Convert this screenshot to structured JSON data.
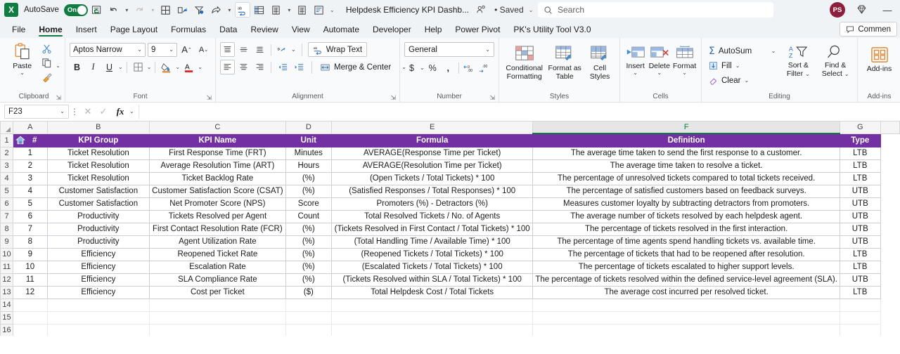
{
  "titlebar": {
    "app_logo": "excel-logo",
    "autosave_label": "AutoSave",
    "autosave_state": "On",
    "document_title": "Helpdesk Efficiency KPI Dashb...",
    "saved_status": "• Saved",
    "search_placeholder": "Search",
    "avatar_initials": "PS",
    "qat": [
      {
        "name": "refresh-all-icon",
        "glyph": "↻"
      },
      {
        "name": "undo-icon",
        "glyph": "↶"
      },
      {
        "name": "redo-icon",
        "glyph": "↷"
      },
      {
        "name": "all-borders-icon",
        "glyph": "⊞"
      },
      {
        "name": "insert-chart-icon",
        "glyph": "↗"
      },
      {
        "name": "filter-settings-icon",
        "glyph": "∇"
      },
      {
        "name": "share-icon",
        "glyph": "➦"
      },
      {
        "name": "spelling-icon",
        "glyph": "abc"
      },
      {
        "name": "freeze-panes-icon",
        "glyph": "▦"
      },
      {
        "name": "calculator-icon",
        "glyph": "⌸"
      },
      {
        "name": "calculate-sheet-icon",
        "glyph": "⌸"
      },
      {
        "name": "custom-sort-icon",
        "glyph": "≣"
      },
      {
        "name": "customize-qat-icon",
        "glyph": "⌄"
      }
    ]
  },
  "tabs": [
    {
      "label": "File",
      "selected": false
    },
    {
      "label": "Home",
      "selected": true
    },
    {
      "label": "Insert",
      "selected": false
    },
    {
      "label": "Page Layout",
      "selected": false
    },
    {
      "label": "Formulas",
      "selected": false
    },
    {
      "label": "Data",
      "selected": false
    },
    {
      "label": "Review",
      "selected": false
    },
    {
      "label": "View",
      "selected": false
    },
    {
      "label": "Automate",
      "selected": false
    },
    {
      "label": "Developer",
      "selected": false
    },
    {
      "label": "Help",
      "selected": false
    },
    {
      "label": "Power Pivot",
      "selected": false
    },
    {
      "label": "PK's Utility Tool V3.0",
      "selected": false
    }
  ],
  "comment_button": "Commen",
  "ribbon": {
    "clipboard": {
      "group_label": "Clipboard",
      "paste_label": "Paste",
      "cut_label": "Cut",
      "copy_label": "Copy",
      "format_painter_label": "Format Painter"
    },
    "font": {
      "group_label": "Font",
      "font_name": "Aptos Narrow",
      "font_size": "9",
      "grow_font": "A",
      "shrink_font": "A",
      "bold": "B",
      "italic": "I",
      "underline": "U",
      "borders": "borders",
      "fill_color": "fill-color",
      "font_color": "font-color"
    },
    "alignment": {
      "group_label": "Alignment",
      "wrap_text_label": "Wrap Text",
      "merge_center_label": "Merge & Center",
      "orientation": "orientation"
    },
    "number": {
      "group_label": "Number",
      "format_value": "General",
      "currency": "$",
      "percent": "%",
      "comma": ",",
      "increase_decimal": ".00",
      "decrease_decimal": ".00"
    },
    "styles": {
      "group_label": "Styles",
      "conditional_formatting": "Conditional\nFormatting",
      "cf_line1": "Conditional",
      "cf_line2": "Formatting",
      "fat_line1": "Format as",
      "fat_line2": "Table",
      "cs_line1": "Cell",
      "cs_line2": "Styles"
    },
    "cells": {
      "group_label": "Cells",
      "insert_label": "Insert",
      "delete_label": "Delete",
      "format_label": "Format"
    },
    "editing": {
      "group_label": "Editing",
      "autosum_label": "AutoSum",
      "fill_label": "Fill",
      "clear_label": "Clear",
      "sort_filter_line1": "Sort &",
      "sort_filter_line2": "Filter",
      "find_select_line1": "Find &",
      "find_select_line2": "Select"
    },
    "addins": {
      "group_label": "Add-ins",
      "button_label": "Add-ins"
    }
  },
  "formula_bar": {
    "name_box_value": "F23",
    "formula_value": "",
    "cancel_icon": "✕",
    "enter_icon": "✓",
    "fx_label": "fx"
  },
  "grid": {
    "columns": [
      "A",
      "B",
      "C",
      "D",
      "E",
      "F",
      "G"
    ],
    "selected_column": "F",
    "row_numbers": [
      "1",
      "2",
      "3",
      "4",
      "5",
      "6",
      "7",
      "8",
      "9",
      "10",
      "11",
      "12",
      "13",
      "14",
      "15",
      "16"
    ],
    "header_row": {
      "home_icon": "home-icon",
      "number_sign": "#",
      "kpi_group": "KPI Group",
      "kpi_name": "KPI Name",
      "unit": "Unit",
      "formula": "Formula",
      "definition": "Definition",
      "type": "Type"
    },
    "header_color": "#7230a3",
    "rows": [
      {
        "num": "1",
        "group": "Ticket Resolution",
        "name": "First Response Time (FRT)",
        "unit": "Minutes",
        "formula": "AVERAGE(Response Time per Ticket)",
        "definition": "The average time taken to send the first response to a customer.",
        "type": "LTB"
      },
      {
        "num": "2",
        "group": "Ticket Resolution",
        "name": "Average Resolution Time (ART)",
        "unit": "Hours",
        "formula": "AVERAGE(Resolution Time per Ticket)",
        "definition": "The average time taken to resolve a ticket.",
        "type": "LTB"
      },
      {
        "num": "3",
        "group": "Ticket Resolution",
        "name": "Ticket Backlog Rate",
        "unit": "(%)",
        "formula": "(Open Tickets / Total Tickets) * 100",
        "definition": "The percentage of unresolved tickets compared to total tickets received.",
        "type": "LTB"
      },
      {
        "num": "4",
        "group": "Customer Satisfaction",
        "name": "Customer Satisfaction Score (CSAT)",
        "unit": "(%)",
        "formula": "(Satisfied Responses / Total Responses) * 100",
        "definition": "The percentage of satisfied customers based on feedback surveys.",
        "type": "UTB"
      },
      {
        "num": "5",
        "group": "Customer Satisfaction",
        "name": "Net Promoter Score (NPS)",
        "unit": "Score",
        "formula": "Promoters (%) - Detractors (%)",
        "definition": "Measures customer loyalty by subtracting detractors from promoters.",
        "type": "UTB"
      },
      {
        "num": "6",
        "group": "Productivity",
        "name": "Tickets Resolved per Agent",
        "unit": "Count",
        "formula": "Total Resolved Tickets / No. of Agents",
        "definition": "The average number of tickets resolved by each helpdesk agent.",
        "type": "UTB"
      },
      {
        "num": "7",
        "group": "Productivity",
        "name": "First Contact Resolution Rate (FCR)",
        "unit": "(%)",
        "formula": "(Tickets Resolved in First Contact / Total Tickets) * 100",
        "definition": "The percentage of tickets resolved in the first interaction.",
        "type": "UTB"
      },
      {
        "num": "8",
        "group": "Productivity",
        "name": "Agent Utilization Rate",
        "unit": "(%)",
        "formula": "(Total Handling Time / Available Time) * 100",
        "definition": "The percentage of time agents spend handling tickets vs. available time.",
        "type": "UTB"
      },
      {
        "num": "9",
        "group": "Efficiency",
        "name": "Reopened Ticket Rate",
        "unit": "(%)",
        "formula": "(Reopened Tickets / Total Tickets) * 100",
        "definition": "The percentage of tickets that had to be reopened after resolution.",
        "type": "LTB"
      },
      {
        "num": "10",
        "group": "Efficiency",
        "name": "Escalation Rate",
        "unit": "(%)",
        "formula": "(Escalated Tickets / Total Tickets) * 100",
        "definition": "The percentage of tickets escalated to higher support levels.",
        "type": "LTB"
      },
      {
        "num": "11",
        "group": "Efficiency",
        "name": "SLA Compliance Rate",
        "unit": "(%)",
        "formula": "(Tickets Resolved within SLA / Total Tickets) * 100",
        "definition": "The percentage of tickets resolved within the defined service-level agreement (SLA).",
        "type": "UTB"
      },
      {
        "num": "12",
        "group": "Efficiency",
        "name": "Cost per Ticket",
        "unit": "($)",
        "formula": "Total Helpdesk Cost / Total Tickets",
        "definition": "The average cost incurred per resolved ticket.",
        "type": "LTB"
      }
    ]
  }
}
